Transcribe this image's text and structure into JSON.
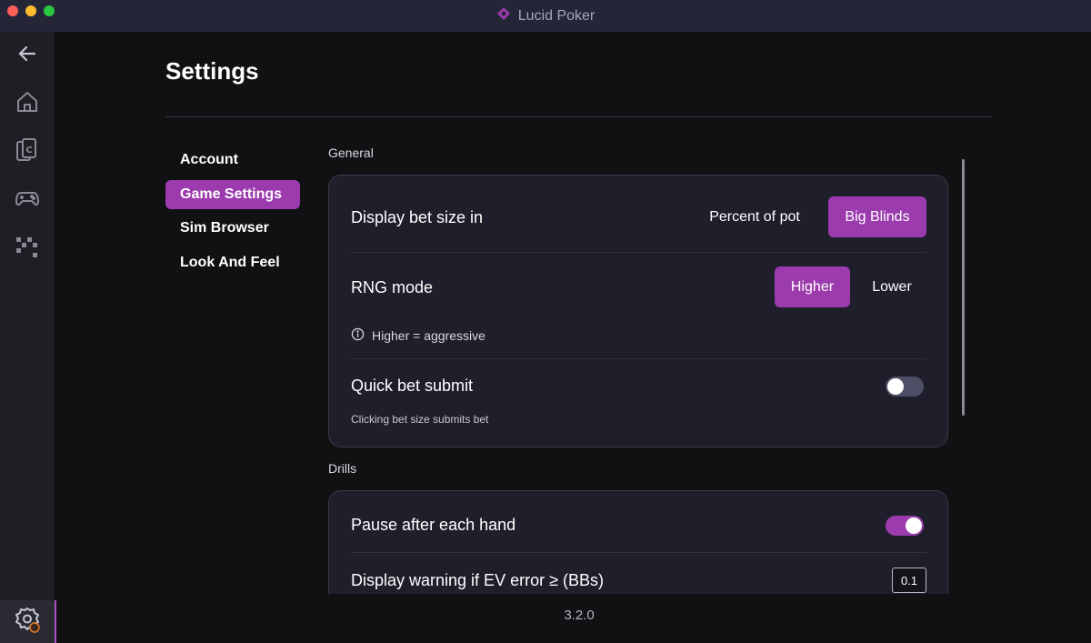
{
  "window": {
    "title": "Lucid Poker"
  },
  "sidebar": {
    "items": [
      {
        "icon": "arrow-left-icon",
        "label": "Back"
      },
      {
        "icon": "home-icon",
        "label": "Home"
      },
      {
        "icon": "cards-icon",
        "label": "Cards"
      },
      {
        "icon": "gamepad-icon",
        "label": "Play"
      },
      {
        "icon": "grid-icon",
        "label": "Sims"
      }
    ],
    "settings_icon": "settings-gear-icon"
  },
  "page": {
    "title": "Settings",
    "version": "3.2.0"
  },
  "nav": {
    "items": [
      "Account",
      "Game Settings",
      "Sim Browser",
      "Look And Feel"
    ],
    "active": "Game Settings"
  },
  "general": {
    "label": "General",
    "bet_size": {
      "title": "Display bet size in",
      "options": [
        "Percent of pot",
        "Big Blinds"
      ],
      "selected": "Big Blinds"
    },
    "rng_mode": {
      "title": "RNG mode",
      "options": [
        "Higher",
        "Lower"
      ],
      "selected": "Higher",
      "hint": "Higher = aggressive"
    },
    "quick_bet": {
      "title": "Quick bet submit",
      "description": "Clicking bet size submits bet",
      "enabled": false
    }
  },
  "drills": {
    "label": "Drills",
    "pause_after_hand": {
      "title": "Pause after each hand",
      "enabled": true
    },
    "ev_warning": {
      "title": "Display warning if EV error ≥ (BBs)",
      "value": "0.1"
    }
  },
  "colors": {
    "accent": "#9b3bad",
    "titlebar": "#252538",
    "card": "#1f1f2c",
    "background": "#111113"
  }
}
